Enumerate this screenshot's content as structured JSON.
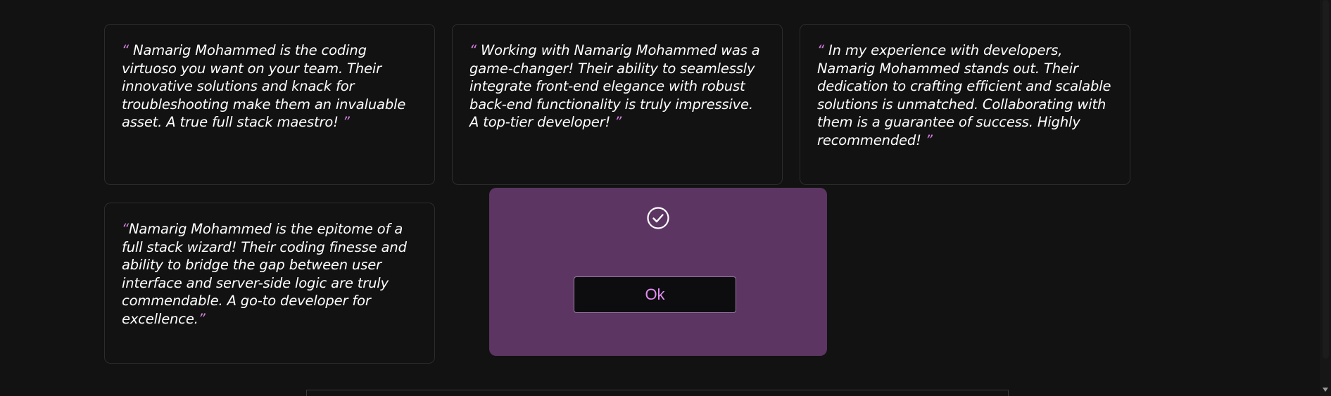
{
  "testimonials": [
    {
      "open_quote": "“ ",
      "text": "Namarig Mohammed is the coding virtuoso you want on your team. Their innovative solutions and knack for troubleshooting make them an invaluable asset. A true full stack maestro!",
      "close_quote": " ”"
    },
    {
      "open_quote": "“ ",
      "text": "Working with Namarig Mohammed was a game-changer! Their ability to seamlessly integrate front-end elegance with robust back-end functionality is truly impressive. A top-tier developer!",
      "close_quote": " ”"
    },
    {
      "open_quote": "“ ",
      "text": "In my experience with developers, Namarig Mohammed stands out. Their dedication to crafting efficient and scalable solutions is unmatched. Collaborating with them is a guarantee of success. Highly recommended!",
      "close_quote": " ”"
    },
    {
      "open_quote": "“",
      "text": "Namarig Mohammed is the epitome of a full stack wizard! Their coding finesse and ability to bridge the gap between user interface and server-side logic are truly commendable. A go-to developer for excellence.",
      "close_quote": "”"
    }
  ],
  "modal": {
    "icon": "check-circle-icon",
    "ok_label": "Ok"
  },
  "colors": {
    "background": "#121212",
    "modal_background": "#5c3563",
    "quote_mark": "#d47fe0",
    "ok_text": "#e38ef2"
  }
}
